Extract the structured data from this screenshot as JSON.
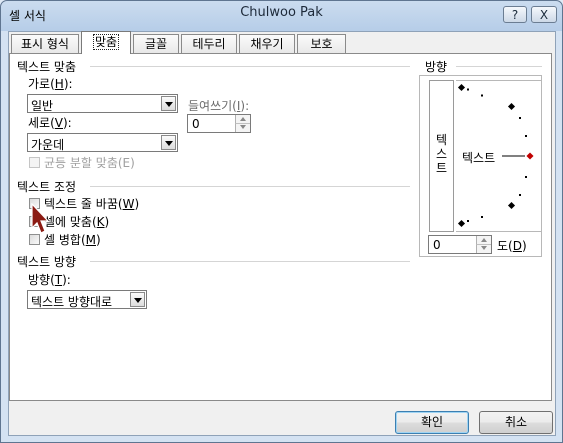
{
  "window": {
    "title": "셀 서식",
    "owner": "Chulwoo Pak",
    "help_label": "?",
    "close_label": "X"
  },
  "tabs": [
    {
      "label": "표시 형식"
    },
    {
      "label": "맞춤"
    },
    {
      "label": "글꼴"
    },
    {
      "label": "테두리"
    },
    {
      "label": "채우기"
    },
    {
      "label": "보호"
    }
  ],
  "text_alignment": {
    "header": "텍스트 맞춤",
    "horizontal_label": "가로",
    "horizontal_key": "H",
    "horizontal_value": "일반",
    "vertical_label": "세로",
    "vertical_key": "V",
    "vertical_value": "가운데",
    "indent_label": "들여쓰기",
    "indent_key": "I",
    "indent_value": "0",
    "justify_distributed": "균등 분할 맞춤(E)"
  },
  "text_control": {
    "header": "텍스트 조정",
    "wrap_text": "텍스트 줄 바꿈",
    "wrap_key": "W",
    "shrink_to_fit": "셀에 맞춤",
    "shrink_key": "K",
    "merge_cells": "셀 병합",
    "merge_key": "M"
  },
  "text_direction": {
    "header": "텍스트 방향",
    "direction_label": "방향",
    "direction_key": "T",
    "direction_value": "텍스트 방향대로"
  },
  "orientation": {
    "header": "방향",
    "vertical_text": "텍스트",
    "dial_text": "텍스트",
    "degrees_value": "0",
    "degrees_label": "도",
    "degrees_key": "D",
    "pointer_color": "#c00000"
  },
  "buttons": {
    "ok": "확인",
    "cancel": "취소"
  }
}
